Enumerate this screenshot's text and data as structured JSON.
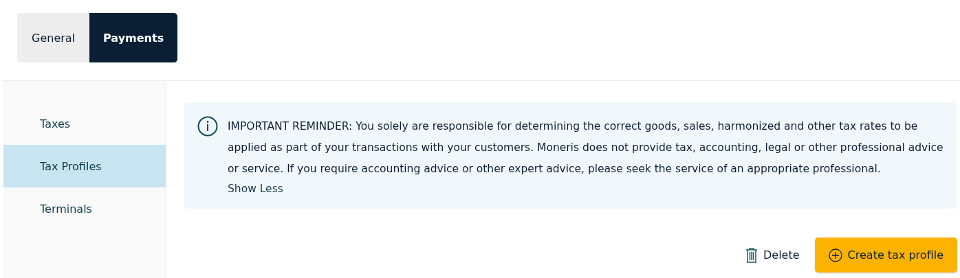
{
  "tabs": [
    {
      "label": "General",
      "selected": false
    },
    {
      "label": "Payments",
      "selected": true
    }
  ],
  "sidebar": {
    "items": [
      {
        "label": "Taxes",
        "selected": false
      },
      {
        "label": "Tax Profiles",
        "selected": true
      },
      {
        "label": "Terminals",
        "selected": false
      }
    ]
  },
  "notice": {
    "text": "IMPORTANT REMINDER: You solely are responsible for determining the correct goods, sales, harmonized and other tax rates to be applied as part of your transactions with your customers. Moneris does not provide tax, accounting, legal or other professional advice or service. If you require accounting advice or other expert advice, please seek the service of an appropriate professional.",
    "toggle": "Show Less"
  },
  "actions": {
    "delete": "Delete",
    "create": "Create tax profile"
  }
}
